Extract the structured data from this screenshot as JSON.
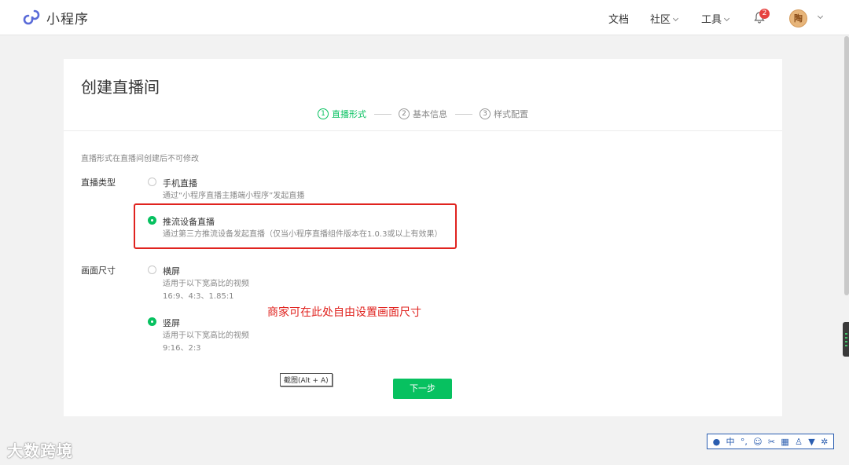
{
  "header": {
    "app_title": "小程序",
    "nav": [
      {
        "label": "文档"
      },
      {
        "label": "社区"
      },
      {
        "label": "工具"
      }
    ],
    "notification_count": "2",
    "avatar_text": "陶",
    "accent_color": "#07c160"
  },
  "page": {
    "title": "创建直播间",
    "steps": [
      {
        "num": "1",
        "label": "直播形式",
        "active": true
      },
      {
        "num": "2",
        "label": "基本信息",
        "active": false
      },
      {
        "num": "3",
        "label": "样式配置",
        "active": false
      }
    ],
    "hint": "直播形式在直播间创建后不可修改",
    "live_type": {
      "label": "直播类型",
      "options": [
        {
          "title": "手机直播",
          "desc": "通过“小程序直播主播端小程序”发起直播",
          "selected": false
        },
        {
          "title": "推流设备直播",
          "desc": "通过第三方推流设备发起直播（仅当小程序直播组件版本在1.0.3或以上有效果）",
          "selected": true
        }
      ]
    },
    "screen_size": {
      "label": "画面尺寸",
      "options": [
        {
          "title": "横屏",
          "desc1": "适用于以下宽高比的视频",
          "desc2": "16:9、4:3、1.85:1",
          "selected": false
        },
        {
          "title": "竖屏",
          "desc1": "适用于以下宽高比的视频",
          "desc2": "9:16、2:3",
          "selected": true
        }
      ]
    },
    "annotation": "商家可在此处自由设置画面尺寸",
    "tooltip": "截图(Alt + A)",
    "next_button": "下一步"
  },
  "watermark": "大数跨境",
  "ime_toolbar": {
    "mode": "中",
    "icons": [
      "user-icon",
      "punctuation-icon",
      "emoji-icon",
      "scissors-icon",
      "keyboard-icon",
      "person-icon",
      "shirt-icon",
      "gear-icon"
    ]
  }
}
